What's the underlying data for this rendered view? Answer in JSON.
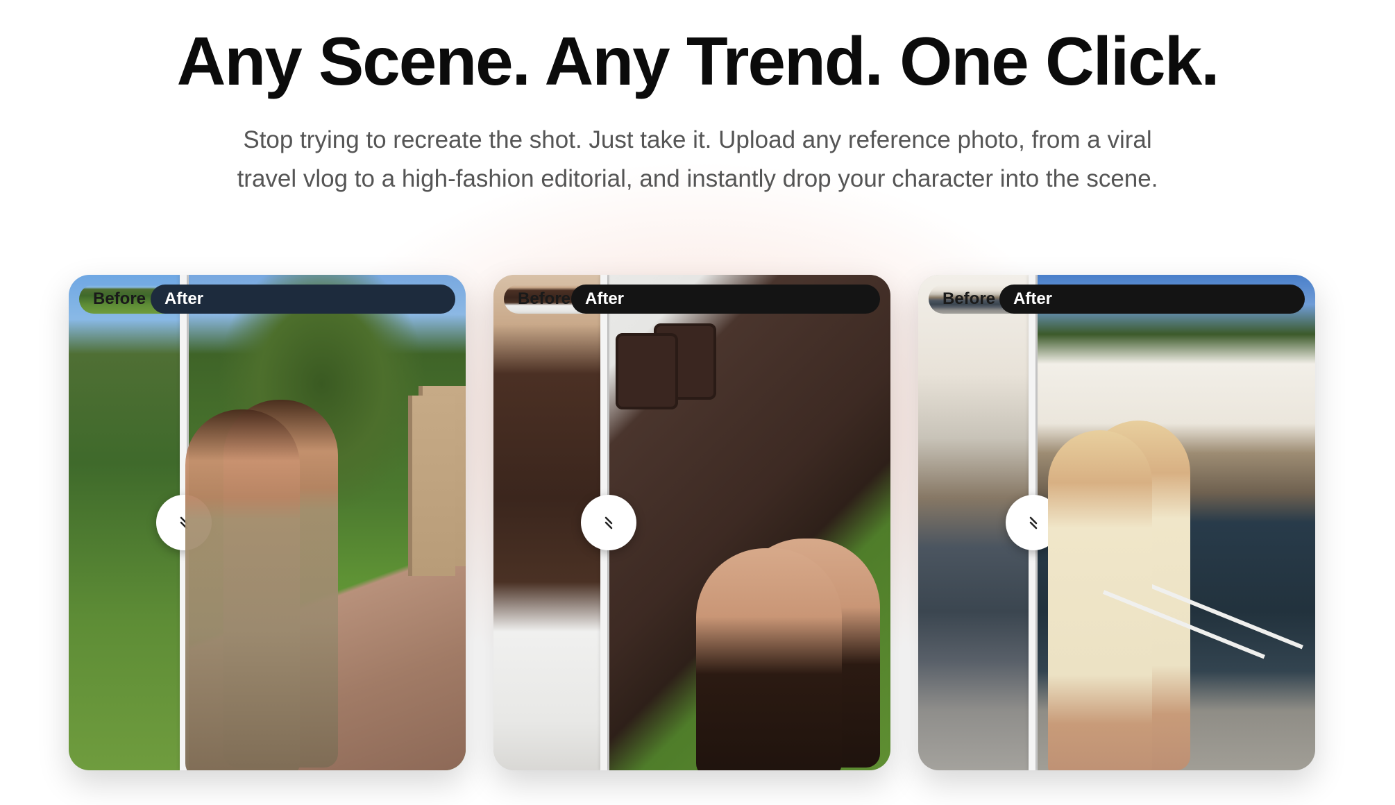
{
  "hero": {
    "headline": "Any Scene. Any Trend. One Click.",
    "subheadline": "Stop trying to recreate the shot. Just take it. Upload any reference photo, from a viral travel vlog to a high-fashion editorial, and instantly drop your character into the scene."
  },
  "comparisons": [
    {
      "before_label": "Before",
      "after_label": "After",
      "after_badge_color": "#1d2b3d"
    },
    {
      "before_label": "Before",
      "after_label": "After",
      "after_badge_color": "#141414"
    },
    {
      "before_label": "Before",
      "after_label": "After",
      "after_badge_color": "#141414"
    }
  ],
  "icons": {
    "slider_handle": "drag-handle-icon"
  }
}
